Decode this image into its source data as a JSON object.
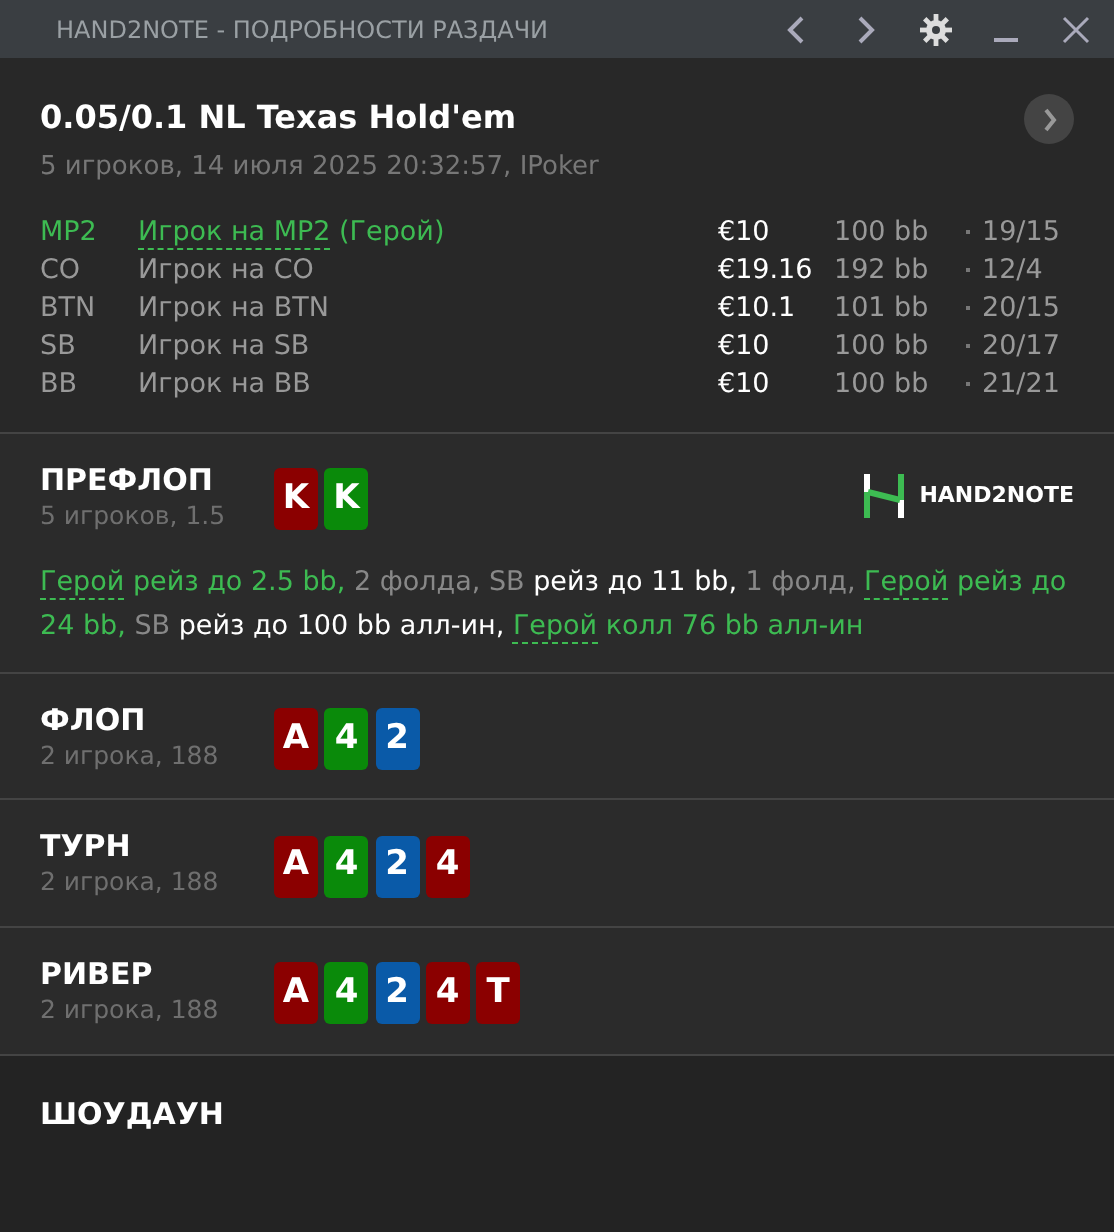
{
  "window": {
    "title": "HAND2NOTE - ПОДРОБНОСТИ РАЗДАЧИ"
  },
  "hand": {
    "title": "0.05/0.1 NL Texas Hold'em",
    "subtitle": "5 игроков, 14 июля 2025 20:32:57, IPoker"
  },
  "players": [
    {
      "position": "MP2",
      "name": "Игрок на MP2",
      "hero": true,
      "hero_tag": "(Герой)",
      "stack": "€10",
      "bb": "100 bb",
      "stat": "19/15"
    },
    {
      "position": "CO",
      "name": "Игрок на CO",
      "hero": false,
      "stack": "€19.16",
      "bb": "192 bb",
      "stat": "12/4"
    },
    {
      "position": "BTN",
      "name": "Игрок на BTN",
      "hero": false,
      "stack": "€10.1",
      "bb": "101 bb",
      "stat": "20/15"
    },
    {
      "position": "SB",
      "name": "Игрок на SB",
      "hero": false,
      "stack": "€10",
      "bb": "100 bb",
      "stat": "20/17"
    },
    {
      "position": "BB",
      "name": "Игрок на BB",
      "hero": false,
      "stack": "€10",
      "bb": "100 bb",
      "stat": "21/21"
    }
  ],
  "streets": [
    {
      "name": "ПРЕФЛОП",
      "info": "5 игроков, 1.5",
      "logo": "HAND2NOTE",
      "cards": [
        {
          "rank": "K",
          "color": "#8b0000"
        },
        {
          "rank": "K",
          "color": "#0a8a0a"
        }
      ],
      "actions": [
        {
          "kind": "hero-link",
          "text": "Герой"
        },
        {
          "kind": "hero",
          "text": "рейз до 2.5 bb,"
        },
        {
          "kind": "muted",
          "text": "2 фолда, SB"
        },
        {
          "kind": "action",
          "text": "рейз до 11 bb,"
        },
        {
          "kind": "muted",
          "text": "1 фолд,"
        },
        {
          "kind": "hero-link",
          "text": "Герой"
        },
        {
          "kind": "hero",
          "text": "рейз до 24 bb,"
        },
        {
          "kind": "muted",
          "text": "SB"
        },
        {
          "kind": "action",
          "text": "рейз до 100 bb алл-ин,"
        },
        {
          "kind": "hero-link",
          "text": "Герой"
        },
        {
          "kind": "hero",
          "text": "колл 76 bb алл-ин"
        }
      ]
    },
    {
      "name": "ФЛОП",
      "info": "2 игрока, 188",
      "cards": [
        {
          "rank": "A",
          "color": "#8b0000"
        },
        {
          "rank": "4",
          "color": "#0a8a0a"
        },
        {
          "rank": "2",
          "color": "#0a5aa8"
        }
      ]
    },
    {
      "name": "ТУРН",
      "info": "2 игрока, 188",
      "cards": [
        {
          "rank": "A",
          "color": "#8b0000"
        },
        {
          "rank": "4",
          "color": "#0a8a0a"
        },
        {
          "rank": "2",
          "color": "#0a5aa8"
        },
        {
          "rank": "4",
          "color": "#8b0000"
        }
      ]
    },
    {
      "name": "РИВЕР",
      "info": "2 игрока, 188",
      "cards": [
        {
          "rank": "A",
          "color": "#8b0000"
        },
        {
          "rank": "4",
          "color": "#0a8a0a"
        },
        {
          "rank": "2",
          "color": "#0a5aa8"
        },
        {
          "rank": "4",
          "color": "#8b0000"
        },
        {
          "rank": "T",
          "color": "#8b0000"
        }
      ]
    }
  ],
  "showdown": {
    "title": "ШОУДАУН"
  }
}
